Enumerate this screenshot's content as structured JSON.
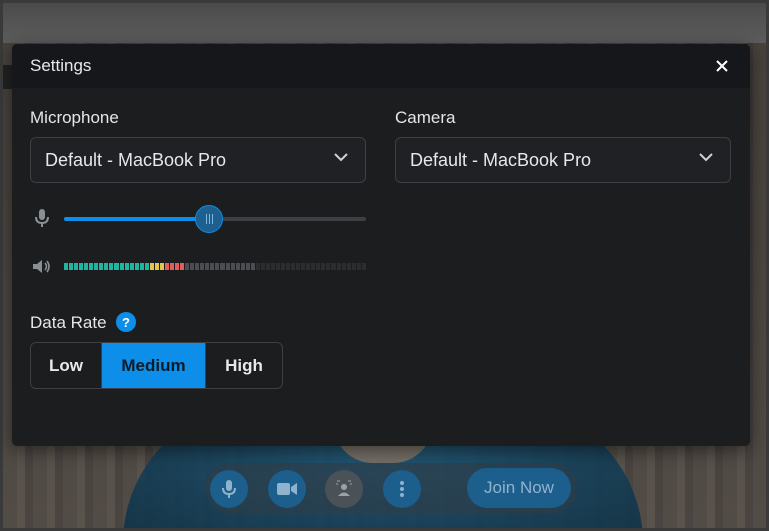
{
  "dialog": {
    "title": "Settings",
    "close_icon": "close-icon"
  },
  "microphone": {
    "label": "Microphone",
    "selected": "Default - MacBook Pro",
    "volume_percent": 48
  },
  "camera": {
    "label": "Camera",
    "selected": "Default - MacBook Pro"
  },
  "speaker": {
    "level_segments_total": 60,
    "level_segments_lit": 24
  },
  "data_rate": {
    "label": "Data Rate",
    "help_glyph": "?",
    "options": [
      "Low",
      "Medium",
      "High"
    ],
    "selected": "Medium"
  },
  "toolbar": {
    "join_label": "Join Now"
  },
  "colors": {
    "accent": "#0d8ee8",
    "meter_green": "#1fb5a0",
    "meter_yellow": "#e6c44a",
    "meter_red": "#e35d5d",
    "meter_off": "#4a4e52"
  }
}
